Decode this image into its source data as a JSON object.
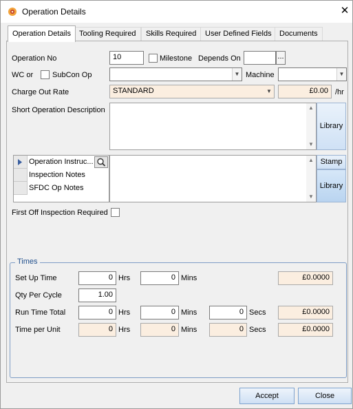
{
  "window": {
    "title": "Operation Details",
    "close_symbol": "✕"
  },
  "tabs": [
    "Operation Details",
    "Tooling Required",
    "Skills Required",
    "User Defined Fields",
    "Documents"
  ],
  "operation": {
    "op_no_label": "Operation No",
    "op_no_value": "10",
    "milestone_label": "Milestone",
    "milestone_checked": false,
    "depends_on_label": "Depends On",
    "depends_on_value": "",
    "depends_browse": "...",
    "wc_or_label": "WC or",
    "subcon_label": "SubCon Op",
    "subcon_checked": false,
    "wc_value": "",
    "machine_label": "Machine",
    "machine_value": "",
    "charge_out_label": "Charge Out Rate",
    "charge_out_value": "STANDARD",
    "charge_out_amount": "£0.00",
    "per_hour": "/hr",
    "short_desc_label": "Short Operation Description",
    "short_desc_value": "",
    "library_label": "Library",
    "stamp_label": "Stamp",
    "library2_label": "Library",
    "notes_items": [
      "Operation Instruc...",
      "Inspection Notes",
      "SFDC Op Notes"
    ],
    "first_off_label": "First Off Inspection Required",
    "first_off_checked": false
  },
  "times": {
    "group_label": "Times",
    "rows": [
      {
        "label": "Set Up Time",
        "hrs": "0",
        "hrs_unit": "Hrs",
        "mins": "0",
        "mins_unit": "Mins",
        "cost": "£0.0000"
      },
      {
        "label": "Qty Per Cycle",
        "value": "1.00"
      },
      {
        "label": "Run Time Total",
        "hrs": "0",
        "hrs_unit": "Hrs",
        "mins": "0",
        "mins_unit": "Mins",
        "secs": "0",
        "secs_unit": "Secs",
        "cost": "£0.0000"
      },
      {
        "label": "Time per Unit",
        "hrs": "0",
        "hrs_unit": "Hrs",
        "mins": "0",
        "mins_unit": "Mins",
        "secs": "0",
        "secs_unit": "Secs",
        "cost": "£0.0000"
      }
    ]
  },
  "buttons": {
    "accept": "Accept",
    "close": "Close"
  }
}
